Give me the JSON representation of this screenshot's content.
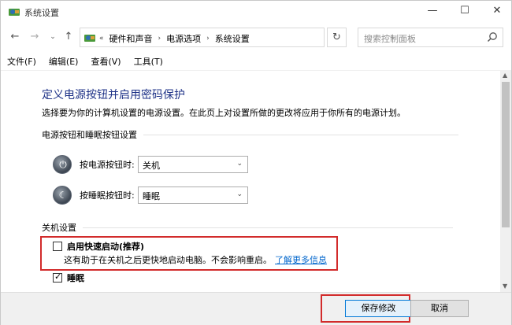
{
  "window": {
    "title": "系统设置",
    "min": "—",
    "max": "☐",
    "close": "✕"
  },
  "nav": {
    "back": "←",
    "forward": "→",
    "dropdown": "⌄",
    "up": "↑",
    "breadcrumb": [
      "硬件和声音",
      "电源选项",
      "系统设置"
    ],
    "refresh": "↻",
    "search_placeholder": "搜索控制面板"
  },
  "menu": [
    "文件(F)",
    "编辑(E)",
    "查看(V)",
    "工具(T)"
  ],
  "page": {
    "title": "定义电源按钮并启用密码保护",
    "description": "选择要为你的计算机设置的电源设置。在此页上对设置所做的更改将应用于你所有的电源计划。",
    "section_buttons": "电源按钮和睡眠按钮设置",
    "power_button_label": "按电源按钮时:",
    "power_button_value": "关机",
    "sleep_button_label": "按睡眠按钮时:",
    "sleep_button_value": "睡眠",
    "section_shutdown": "关机设置",
    "fast_startup_label": "启用快速启动(推荐)",
    "fast_startup_checked": false,
    "fast_startup_desc": "这有助于在关机之后更快地启动电脑。不会影响重启。",
    "fast_startup_link": "了解更多信息",
    "sleep_label": "睡眠",
    "sleep_checked": true
  },
  "footer": {
    "save": "保存修改",
    "cancel": "取消"
  },
  "colors": {
    "title": "#1e3287",
    "link": "#0066cc",
    "highlight": "#d22b2b"
  }
}
